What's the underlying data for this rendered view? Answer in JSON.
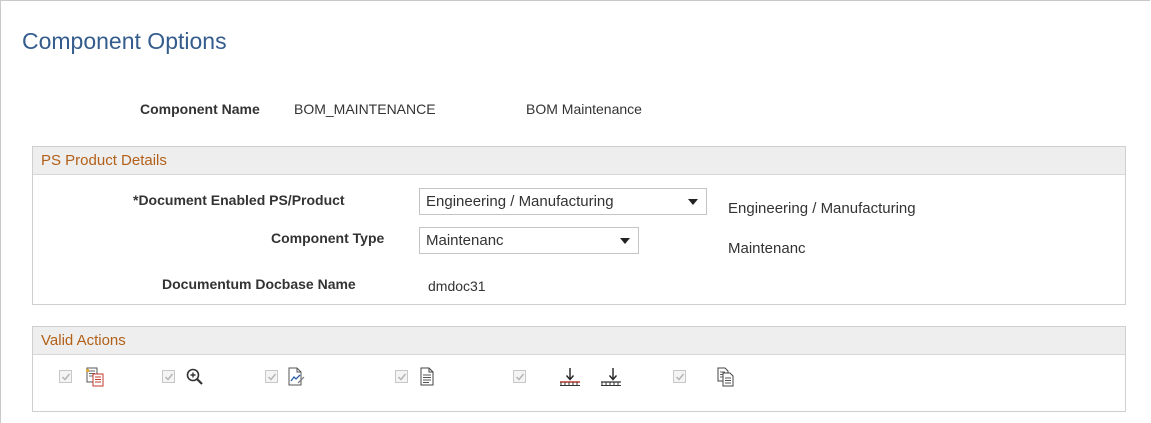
{
  "page": {
    "title": "Component Options"
  },
  "component": {
    "name_label": "Component Name",
    "name_value": "BOM_MAINTENANCE",
    "description": "BOM Maintenance"
  },
  "ps_product_details": {
    "header": "PS Product Details",
    "document_enabled_label": "*Document Enabled PS/Product",
    "document_enabled_value": "Engineering / Manufacturing",
    "document_enabled_desc": "Engineering / Manufacturing",
    "component_type_label": "Component Type",
    "component_type_value": "Maintenanc",
    "component_type_desc": "Maintenanc",
    "docbase_label": "Documentum Docbase Name",
    "docbase_value": "dmdoc31"
  },
  "valid_actions": {
    "header": "Valid Actions",
    "items": [
      {
        "icon": "document-red-list-icon",
        "checked": true
      },
      {
        "icon": "magnify-plus-icon",
        "checked": true
      },
      {
        "icon": "document-chart-icon",
        "checked": true
      },
      {
        "icon": "document-icon",
        "checked": true
      },
      {
        "icon": "download-to-ruler-icons",
        "checked": true
      },
      {
        "icon": "copy-documents-icon",
        "checked": true
      }
    ]
  },
  "colors": {
    "title": "#345c8c",
    "group_header_text": "#b25f17",
    "group_header_bg": "#eeeeee"
  }
}
